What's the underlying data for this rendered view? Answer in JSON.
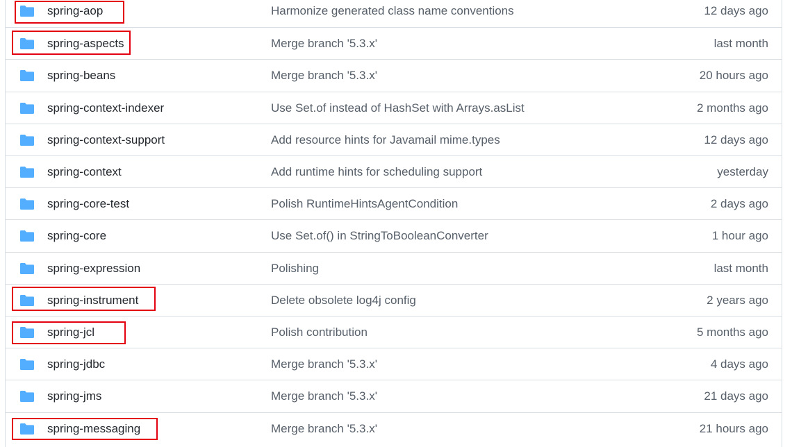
{
  "colors": {
    "folder": "#54aeff",
    "highlight": "#e3000f",
    "name_text": "#24292f",
    "secondary_text": "#57606a",
    "border": "#d8dee4"
  },
  "folder_icon": "folder-icon",
  "rows": [
    {
      "name": "spring-aop",
      "commit": "Harmonize generated class name conventions",
      "age": "12 days ago",
      "highlighted": true
    },
    {
      "name": "spring-aspects",
      "commit": "Merge branch '5.3.x'",
      "age": "last month",
      "highlighted": true
    },
    {
      "name": "spring-beans",
      "commit": "Merge branch '5.3.x'",
      "age": "20 hours ago",
      "highlighted": false
    },
    {
      "name": "spring-context-indexer",
      "commit": "Use Set.of instead of HashSet with Arrays.asList",
      "age": "2 months ago",
      "highlighted": false
    },
    {
      "name": "spring-context-support",
      "commit": "Add resource hints for Javamail mime.types",
      "age": "12 days ago",
      "highlighted": false
    },
    {
      "name": "spring-context",
      "commit": "Add runtime hints for scheduling support",
      "age": "yesterday",
      "highlighted": false
    },
    {
      "name": "spring-core-test",
      "commit": "Polish RuntimeHintsAgentCondition",
      "age": "2 days ago",
      "highlighted": false
    },
    {
      "name": "spring-core",
      "commit": "Use Set.of() in StringToBooleanConverter",
      "age": "1 hour ago",
      "highlighted": false
    },
    {
      "name": "spring-expression",
      "commit": "Polishing",
      "age": "last month",
      "highlighted": false
    },
    {
      "name": "spring-instrument",
      "commit": "Delete obsolete log4j config",
      "age": "2 years ago",
      "highlighted": true
    },
    {
      "name": "spring-jcl",
      "commit": "Polish contribution",
      "age": "5 months ago",
      "highlighted": true
    },
    {
      "name": "spring-jdbc",
      "commit": "Merge branch '5.3.x'",
      "age": "4 days ago",
      "highlighted": false
    },
    {
      "name": "spring-jms",
      "commit": "Merge branch '5.3.x'",
      "age": "21 days ago",
      "highlighted": false
    },
    {
      "name": "spring-messaging",
      "commit": "Merge branch '5.3.x'",
      "age": "21 hours ago",
      "highlighted": true
    }
  ]
}
